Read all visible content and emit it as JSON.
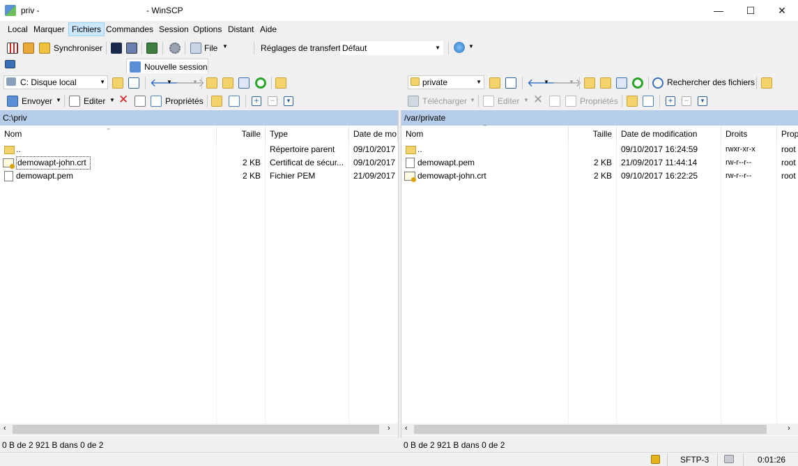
{
  "window": {
    "title_left": "priv -",
    "title_right": "- WinSCP",
    "min": "—",
    "max": "☐",
    "close": "✕"
  },
  "menu": [
    {
      "label": "Local"
    },
    {
      "label": "Marquer"
    },
    {
      "label": "Fichiers"
    },
    {
      "label": "Commandes"
    },
    {
      "label": "Session"
    },
    {
      "label": "Options"
    },
    {
      "label": "Distant"
    },
    {
      "label": "Aide"
    }
  ],
  "toolbar1": {
    "sync_label": "Synchroniser",
    "file_label": "File",
    "transfer_settings_label": "Réglages de transfert",
    "transfer_settings_value": "Défaut"
  },
  "session_tab": {
    "label": "Nouvelle session"
  },
  "local": {
    "drive": "C: Disque local",
    "toolbar": {
      "send": "Envoyer",
      "edit": "Editer",
      "props": "Propriétés"
    },
    "path": "C:\\priv",
    "columns": [
      "Nom",
      "Taille",
      "Type",
      "Date de mo"
    ],
    "rows": [
      {
        "name": "..",
        "size": "",
        "type": "Répertoire parent",
        "date": "09/10/2017",
        "icon": "parent-folder"
      },
      {
        "name": "demowapt-john.crt",
        "size": "2 KB",
        "type": "Certificat de sécur...",
        "date": "09/10/2017",
        "icon": "certificate"
      },
      {
        "name": "demowapt.pem",
        "size": "2 KB",
        "type": "Fichier PEM",
        "date": "21/09/2017",
        "icon": "file"
      }
    ],
    "status": "0 B de 2 921 B dans 0 de 2"
  },
  "remote": {
    "dir": "private",
    "search_label": "Rechercher des fichiers",
    "toolbar": {
      "download": "Télécharger",
      "edit": "Editer",
      "props": "Propriétés"
    },
    "path": "/var/private",
    "columns": [
      "Nom",
      "Taille",
      "Date de modification",
      "Droits",
      "Prop"
    ],
    "rows": [
      {
        "name": "..",
        "size": "",
        "date": "09/10/2017 16:24:59",
        "rights": "rwxr-xr-x",
        "owner": "root",
        "icon": "parent-folder"
      },
      {
        "name": "demowapt.pem",
        "size": "2 KB",
        "date": "21/09/2017 11:44:14",
        "rights": "rw-r--r--",
        "owner": "root",
        "icon": "file"
      },
      {
        "name": "demowapt-john.crt",
        "size": "2 KB",
        "date": "09/10/2017 16:22:25",
        "rights": "rw-r--r--",
        "owner": "root",
        "icon": "certificate"
      }
    ],
    "status": "0 B de 2 921 B dans 0 de 2"
  },
  "bottom": {
    "protocol": "SFTP-3",
    "time": "0:01:26"
  },
  "colors": {
    "path_bar": "#b5cde8",
    "menu_selected": "#cce8ff",
    "folder": "#f5d36b",
    "refresh": "#2aa52a",
    "nav_arrow": "#1e64c8"
  }
}
